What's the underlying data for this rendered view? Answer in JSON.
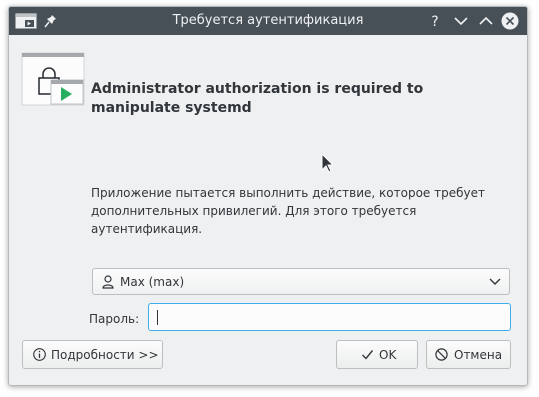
{
  "window": {
    "title": "Требуется аутентификация",
    "titlebar_color": "#475057",
    "titlebar_icons": [
      "app-icon",
      "pin-icon",
      "help-icon",
      "minimize-icon",
      "maximize-icon",
      "close-icon"
    ]
  },
  "dialog": {
    "heading": "Administrator authorization is required to manipulate systemd",
    "description": "Приложение пытается выполнить действие, которое требует дополнительных привилегий. Для этого требуется аутентификация.",
    "main_icon": "lock-window-icon"
  },
  "identity": {
    "selected_user": "Max (max)",
    "icon": "user-icon"
  },
  "password": {
    "label": "Пароль:",
    "value": ""
  },
  "buttons": {
    "details": "Подробности >>",
    "ok": "OK",
    "cancel": "Отмена"
  },
  "accent_color": "#3daee9"
}
